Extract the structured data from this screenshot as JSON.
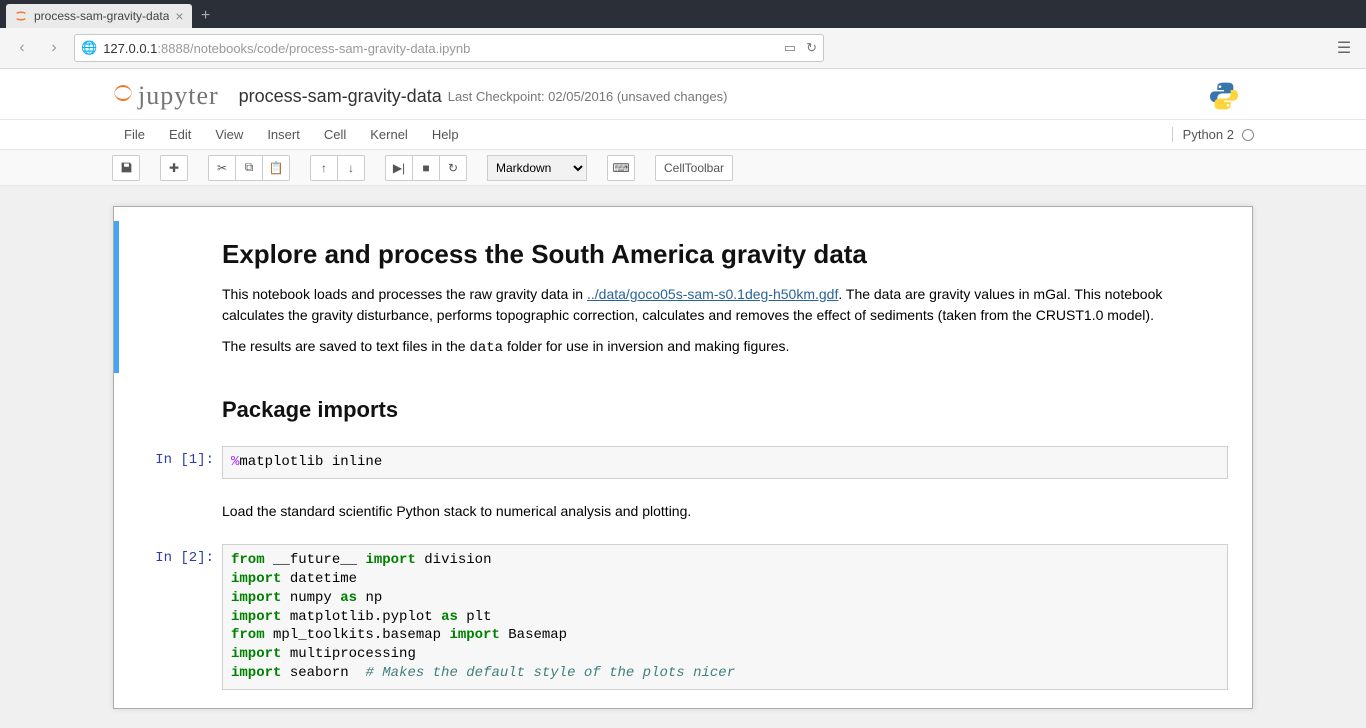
{
  "browser": {
    "tab_title": "process-sam-gravity-data",
    "url_host": "127.0.0.1",
    "url_port": ":8888",
    "url_path": "/notebooks/code/process-sam-gravity-data.ipynb"
  },
  "header": {
    "logo_text": "jupyter",
    "notebook_name": "process-sam-gravity-data",
    "checkpoint": "Last Checkpoint: 02/05/2016 (unsaved changes)",
    "kernel_name": "Python 2"
  },
  "menubar": [
    "File",
    "Edit",
    "View",
    "Insert",
    "Cell",
    "Kernel",
    "Help"
  ],
  "toolbar": {
    "cell_type": "Markdown",
    "cell_toolbar": "CellToolbar"
  },
  "cells": {
    "md1": {
      "h1": "Explore and process the South America gravity data",
      "p1_a": "This notebook loads and processes the raw gravity data in ",
      "p1_link": "../data/goco05s-sam-s0.1deg-h50km.gdf",
      "p1_b": ". The data are gravity values in mGal. This notebook calculates the gravity disturbance, performs topographic correction, calculates and removes the effect of sediments (taken from the CRUST1.0 model).",
      "p2_a": "The results are saved to text files in the ",
      "p2_code": "data",
      "p2_b": " folder for use in inversion and making figures."
    },
    "md2_h2": "Package imports",
    "code1": {
      "prompt": "In [1]:",
      "op": "%",
      "rest": "matplotlib inline"
    },
    "md3": "Load the standard scientific Python stack to numerical analysis and plotting.",
    "code2": {
      "prompt": "In [2]:",
      "l1": {
        "k1": "from",
        "a": " __future__ ",
        "k2": "import",
        "b": " division"
      },
      "l2": {
        "k1": "import",
        "a": " datetime"
      },
      "l3": {
        "k1": "import",
        "a": " numpy ",
        "k2": "as",
        "b": " np"
      },
      "l4": {
        "k1": "import",
        "a": " matplotlib.pyplot ",
        "k2": "as",
        "b": " plt"
      },
      "l5": {
        "k1": "from",
        "a": " mpl_toolkits.basemap ",
        "k2": "import",
        "b": " Basemap"
      },
      "l6": {
        "k1": "import",
        "a": " multiprocessing"
      },
      "l7": {
        "k1": "import",
        "a": " seaborn  ",
        "c": "# Makes the default style of the plots nicer"
      }
    }
  }
}
